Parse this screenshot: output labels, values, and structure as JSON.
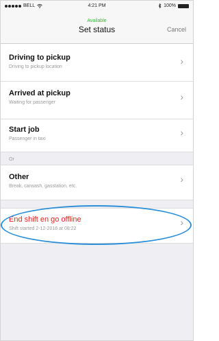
{
  "status_bar": {
    "carrier": "BELL",
    "time": "4:21 PM",
    "battery": "100%"
  },
  "nav": {
    "subtitle": "Available",
    "title": "Set status",
    "cancel_label": "Cancel"
  },
  "rows": [
    {
      "title": "Driving to pickup",
      "subtitle": "Driving to pickup location"
    },
    {
      "title": "Arrived at pickup",
      "subtitle": "Waiting for passenger"
    },
    {
      "title": "Start job",
      "subtitle": "Passenger in taxi"
    }
  ],
  "separator": "Or",
  "other": {
    "title": "Other",
    "subtitle": "Break, carwash, gasstation, etc."
  },
  "end_shift": {
    "title": "End shift en go offline",
    "subtitle": "Shift started 2-12-2016 at 08:22",
    "title_color": "#e2231a"
  },
  "icons": {
    "chevron": "chevron-right-icon",
    "wifi": "wifi-icon",
    "bluetooth": "bluetooth-icon",
    "battery": "battery-icon"
  }
}
